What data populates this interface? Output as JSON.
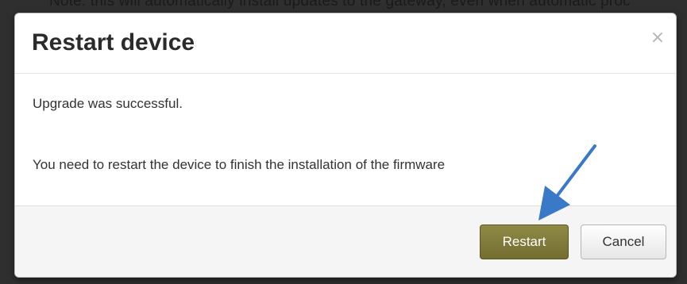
{
  "background": {
    "note_text": "Note: this will automatically install updates to the gateway, even when automatic proc"
  },
  "dialog": {
    "title": "Restart device",
    "close_glyph": "×",
    "body": {
      "line1": "Upgrade was successful.",
      "line2": "You need to restart the device to finish the installation of the firmware"
    },
    "footer": {
      "restart_label": "Restart",
      "cancel_label": "Cancel"
    }
  },
  "annotation": {
    "icon": "arrow-pointer-icon",
    "color": "#3a78c8"
  },
  "colors": {
    "restart_button": "#807a3a",
    "footer_background": "#f5f5f5",
    "title_text": "#2b2b2b"
  }
}
